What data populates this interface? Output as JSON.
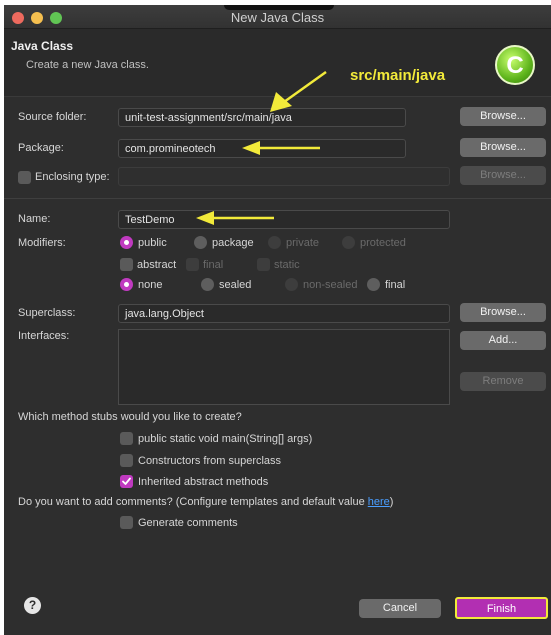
{
  "window": {
    "title": "New Java Class"
  },
  "header": {
    "title": "Java Class",
    "subtitle": "Create a new Java class."
  },
  "annotation": {
    "text": "src/main/java",
    "color": "#f2ea3a"
  },
  "form": {
    "source_folder": {
      "label": "Source folder:",
      "value": "unit-test-assignment/src/main/java",
      "browse": "Browse..."
    },
    "package": {
      "label": "Package:",
      "value": "com.promineotech",
      "browse": "Browse..."
    },
    "enclosing": {
      "label": "Enclosing type:",
      "value": "",
      "browse": "Browse..."
    },
    "name": {
      "label": "Name:",
      "value": "TestDemo"
    },
    "modifiers": {
      "label": "Modifiers:",
      "access": [
        "public",
        "package",
        "private",
        "protected"
      ],
      "flags": [
        "abstract",
        "final",
        "static"
      ],
      "inheritance": [
        "none",
        "sealed",
        "non-sealed",
        "final"
      ]
    },
    "superclass": {
      "label": "Superclass:",
      "value": "java.lang.Object",
      "browse": "Browse..."
    },
    "interfaces": {
      "label": "Interfaces:",
      "add": "Add...",
      "remove": "Remove"
    },
    "stubs": {
      "question": "Which method stubs would you like to create?",
      "items": [
        "public static void main(String[] args)",
        "Constructors from superclass",
        "Inherited abstract methods"
      ]
    },
    "comments": {
      "question": "Do you want to add comments? (Configure templates and default value ",
      "link": "here",
      "question_end": ")",
      "item": "Generate comments"
    }
  },
  "footer": {
    "help": "?",
    "cancel": "Cancel",
    "finish": "Finish"
  },
  "colors": {
    "accent": "#c03ac0",
    "highlight": "#f2ea3a",
    "link": "#4a9eff"
  }
}
